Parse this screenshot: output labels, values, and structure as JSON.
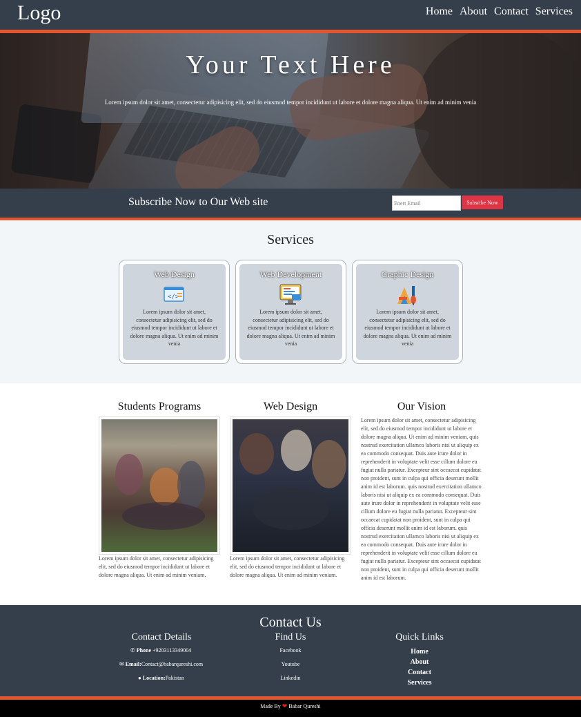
{
  "header": {
    "logo": "Logo",
    "nav": [
      "Home",
      "About",
      "Contact",
      "Services"
    ]
  },
  "hero": {
    "title": "Your Text Here",
    "subtitle": "Lorem ipsum dolor sit amet, consectetur adipisicing elit, sed do eiusmod tempor incididunt ut labore et dolore magna aliqua. Ut enim ad minim venia"
  },
  "subscribe": {
    "text": "Subscribe Now to Our Web site",
    "placeholder": "Enert Email",
    "button": "Subsribe Now"
  },
  "services": {
    "title": "Services",
    "cards": [
      {
        "title": "Web Design",
        "icon": "code-window-icon",
        "text": "Lorem ipsum dolor sit amet, consectetur adipisicing elit, sed do eiusmod tempor incididunt ut labore et dolore magna aliqua. Ut enim ad minim venia"
      },
      {
        "title": "Web Development",
        "icon": "monitor-code-icon",
        "text": "Lorem ipsum dolor sit amet, consectetur adipisicing elit, sed do eiusmod tempor incididunt ut labore et dolore magna aliqua. Ut enim ad minim venia"
      },
      {
        "title": "Graphic Design",
        "icon": "design-tools-icon",
        "text": "Lorem ipsum dolor sit amet, consectetur adipisicing elit, sed do eiusmod tempor incididunt ut labore et dolore magna aliqua. Ut enim ad minim venia"
      }
    ]
  },
  "programs": {
    "students": {
      "title": "Students Programs",
      "text": "Lorem ipsum dolor sit amet, consectetur adipisicing elit, sed do eiusmod tempor incididunt ut labore et dolore magna aliqua. Ut enim ad minim veniam."
    },
    "webdesign": {
      "title": "Web Design",
      "text": "Lorem ipsum dolor sit amet, consectetur adipisicing elit, sed do eiusmod tempor incididunt ut labore et dolore magna aliqua. Ut enim ad minim veniam."
    },
    "vision": {
      "title": "Our Vision",
      "text": "Lorem ipsum dolor sit amet, consectetur adipisicing elit, sed do eiusmod tempor incididunt ut labore et dolore magna aliqua. Ut enim ad minim veniam, quis nostrud exercitation ullamco laboris nisi ut aliquip ex ea commodo consequat. Duis aute irure dolor in reprehenderit in voluptate velit esse cillum dolore eu fugiat nulla pariatur. Excepteur sint occaecat cupidatat non proident, sunt in culpa qui officia deserunt mollit anim id est laborum. quis nostrud exercitation ullamco laboris nisi ut aliquip ex ea commodo consequat. Duis aute irure dolor in reprehenderit in voluptate velit esse cillum dolore eu fugiat nulla pariatur. Excepteur sint occaecat cupidatat non proident, sunt in culpa qui officia deserunt mollit anim id est laborum. quis nostrud exercitation ullamco laboris nisi ut aliquip ex ea commodo consequat. Duis aute irure dolor in reprehenderit in voluptate velit esse cillum dolore eu fugiat nulla pariatur. Excepteur sint occaecat cupidatat non proident, sunt in culpa qui officia deserunt mollit anim id est laborum."
    }
  },
  "footer": {
    "title": "Contact Us",
    "contact": {
      "title": "Contact Details",
      "phone_label": "Phone",
      "phone": "+9203113349004",
      "email_label": "Email:",
      "email": "Contact@babarqureshi.com",
      "location_label": "Location:",
      "location": "Pakistan"
    },
    "find": {
      "title": "Find Us",
      "items": [
        "Facebook",
        "Youtube",
        "Linkedin"
      ]
    },
    "quick": {
      "title": "Quick Links",
      "items": [
        "Home",
        "About",
        "Contact",
        "Services"
      ]
    },
    "credit_prefix": "Made By",
    "credit_name": "Babar Qureshi"
  },
  "colors": {
    "dark": "#343f4b",
    "accent": "#e4572e",
    "button": "#dc3545"
  }
}
